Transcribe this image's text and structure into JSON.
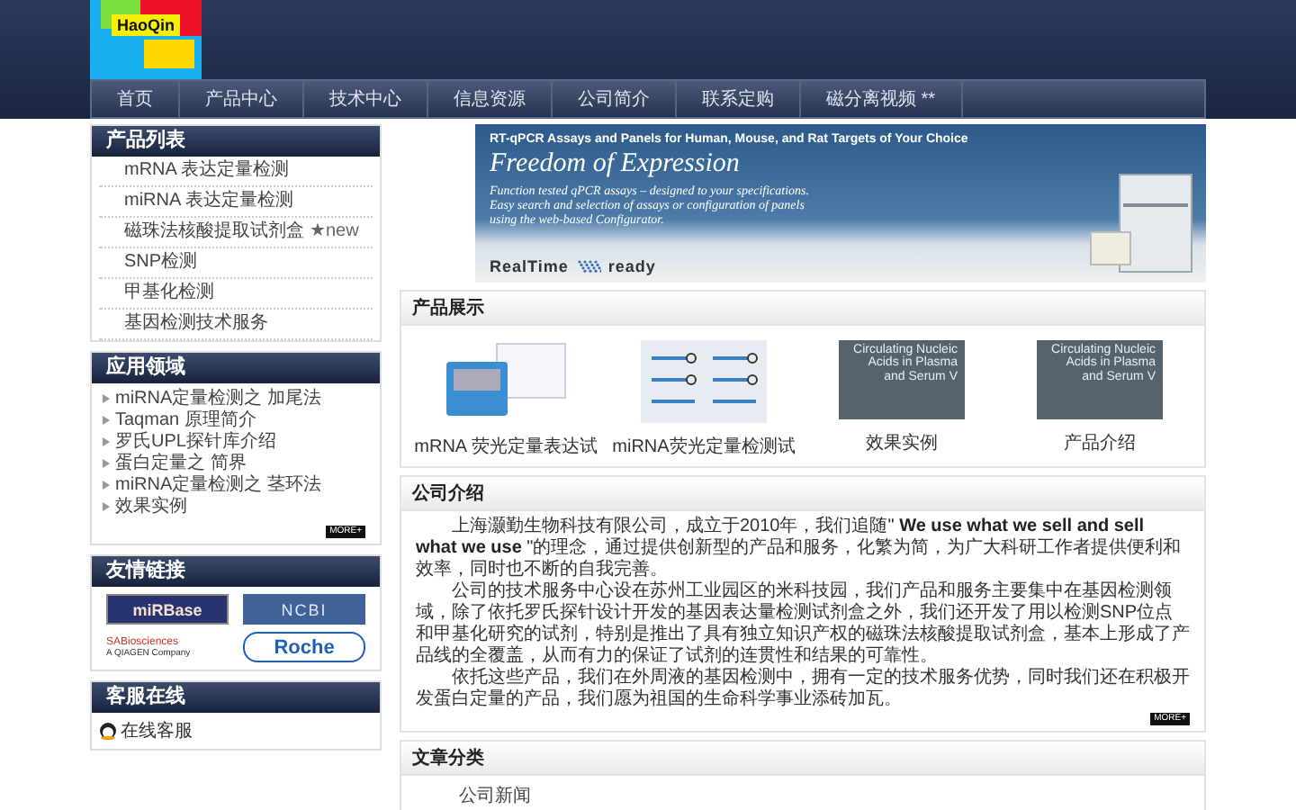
{
  "logo": {
    "name": "HaoQin"
  },
  "nav": [
    {
      "label": "首页"
    },
    {
      "label": "产品中心"
    },
    {
      "label": "技术中心"
    },
    {
      "label": "信息资源"
    },
    {
      "label": "公司简介"
    },
    {
      "label": "联系定购"
    },
    {
      "label": "磁分离视频 **"
    }
  ],
  "sidebar": [
    {
      "kind": "list",
      "title": "产品列表",
      "items": [
        {
          "label": "mRNA 表达定量检测"
        },
        {
          "label": "miRNA 表达定量检测"
        },
        {
          "label": "磁珠法核酸提取试剂盒",
          "badge": "★new"
        },
        {
          "label": "SNP检测"
        },
        {
          "label": "甲基化检测"
        },
        {
          "label": "基因检测技术服务"
        }
      ]
    },
    {
      "kind": "bullets",
      "title": "应用领域",
      "more": "MORE+",
      "items": [
        {
          "label": "miRNA定量检测之 加尾法"
        },
        {
          "label": "Taqman 原理简介"
        },
        {
          "label": "罗氏UPL探针库介绍"
        },
        {
          "label": "蛋白定量之 简界"
        },
        {
          "label": "miRNA定量检测之 茎环法"
        },
        {
          "label": "效果实例"
        }
      ]
    },
    {
      "kind": "links",
      "title": "友情链接",
      "items": [
        {
          "kind": "mirbase",
          "label": "miRBase"
        },
        {
          "kind": "ncbi",
          "label": "NCBI"
        },
        {
          "kind": "sab",
          "label": "SABiosciences",
          "sub": "A QIAGEN Company"
        },
        {
          "kind": "roche",
          "label": "Roche"
        }
      ]
    },
    {
      "kind": "service",
      "title": "客服在线",
      "items": [
        {
          "label": "在线客服"
        }
      ]
    }
  ],
  "banner": {
    "headline": "RT-qPCR Assays and Panels for Human, Mouse, and Rat Targets of Your Choice",
    "title": "Freedom of Expression",
    "body": "Function tested qPCR assays – designed to your specifications. Easy search and selection of assays or configuration of panels using the web-based Configurator.",
    "brand_left": "RealTime",
    "brand_right": "ready"
  },
  "products": {
    "title": "产品展示",
    "items": [
      {
        "kind": "kit",
        "label": "mRNA 荧光定量表达试"
      },
      {
        "kind": "diagram",
        "label": "miRNA荧光定量检测试"
      },
      {
        "kind": "book",
        "cover": "Circulating Nucleic Acids in Plasma and Serum V",
        "label": "效果实例"
      },
      {
        "kind": "book",
        "cover": "Circulating Nucleic Acids in Plasma and Serum V",
        "label": "产品介绍"
      }
    ]
  },
  "intro": {
    "title": "公司介绍",
    "paragraphs": [
      "上海灏勤生物科技有限公司，成立于2010年，我们追随\" **We use what we sell and sell what we use** \"的理念，通过提供创新型的产品和服务，化繁为简，为广大科研工作者提供便利和效率，同时也不断的自我完善。",
      "公司的技术服务中心设在苏州工业园区的米科技园，我们产品和服务主要集中在基因检测领域，除了依托罗氏探针设计开发的基因表达量检测试剂盒之外，我们还开发了用以检测SNP位点和甲基化研究的试剂，特别是推出了具有独立知识产权的磁珠法核酸提取试剂盒，基本上形成了产品线的全覆盖，从而有力的保证了试剂的连贯性和结果的可靠性。",
      "依托这些产品，我们在外周液的基因检测中，拥有一定的技术服务优势，同时我们还在积极开发蛋白定量的产品，我们愿为祖国的生命科学事业添砖加瓦。"
    ],
    "more": "MORE+"
  },
  "articles": {
    "title": "文章分类",
    "items": [
      {
        "label": "公司新闻"
      }
    ]
  }
}
